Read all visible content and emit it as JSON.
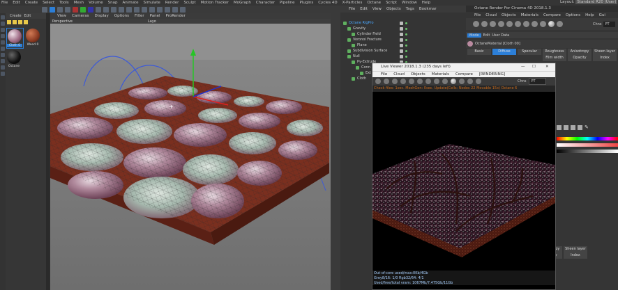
{
  "main_menu": [
    "File",
    "Edit",
    "Create",
    "Select",
    "Tools",
    "Mesh",
    "Volume",
    "Snap",
    "Animate",
    "Simulate",
    "Render",
    "Sculpt",
    "Motion Tracker",
    "MoGraph",
    "Character",
    "Pipeline",
    "Plugins",
    "Cycles 4D",
    "X-Particles",
    "Octane",
    "Script",
    "Window",
    "Help"
  ],
  "layout": {
    "label": "Layout:",
    "value": "Standard R20 (User)"
  },
  "material_manager": {
    "menu": [
      "Create",
      "Edit"
    ],
    "materials": [
      {
        "name": "Cloth 0",
        "color": "#b98aa0",
        "selected": true
      },
      {
        "name": "Wood 0",
        "color": "#8a3a22",
        "selected": false
      },
      {
        "name": "Octane",
        "color": "#1a1a1a",
        "selected": false
      }
    ]
  },
  "viewport": {
    "menu": [
      "View",
      "Cameras",
      "Display",
      "Options",
      "Filter",
      "Panel",
      "ProRender"
    ],
    "label": "Perspective",
    "label_right": "Layo"
  },
  "object_manager": {
    "menu": [
      "File",
      "Edit",
      "View",
      "Objects",
      "Tags",
      "Bookmar"
    ],
    "objects": [
      {
        "name": "Octane RigPro",
        "indent": 0,
        "color": "#4aa8ff"
      },
      {
        "name": "Gravity",
        "indent": 1,
        "color": "#d0d0d0"
      },
      {
        "name": "Cylinder Field",
        "indent": 2,
        "color": "#d0d0d0"
      },
      {
        "name": "Voronoi Fracture",
        "indent": 1,
        "color": "#d0d0d0"
      },
      {
        "name": "Plane",
        "indent": 2,
        "color": "#d0d0d0"
      },
      {
        "name": "Subdivision Surface",
        "indent": 1,
        "color": "#d0d0d0"
      },
      {
        "name": "Null",
        "indent": 1,
        "color": "#d0d0d0"
      },
      {
        "name": "Py-Extrude",
        "indent": 2,
        "color": "#d0d0d0"
      },
      {
        "name": "Conn",
        "indent": 3,
        "color": "#d0d0d0"
      },
      {
        "name": "Ext",
        "indent": 4,
        "color": "#d0d0d0"
      },
      {
        "name": "Cloth",
        "indent": 2,
        "color": "#d0d0d0"
      }
    ]
  },
  "octane_panel": {
    "title": "Octane Render For Cinema 4D 2018.1.3",
    "menu": [
      "File",
      "Cloud",
      "Objects",
      "Materials",
      "Compare",
      "Options",
      "Help",
      "Gui"
    ],
    "chn_label": "Chns",
    "chn_value": "PT",
    "attr_tabs": [
      "Mode",
      "Edit",
      "User Data"
    ],
    "material_name": "OctaneMaterial [Cloth 00]",
    "channels_row1": [
      "Basic",
      "Diffuse",
      "Specular",
      "Roughness",
      "Anisotropy",
      "Sheen layer"
    ],
    "channels_row2": [
      "",
      "",
      "",
      "Film width",
      "Opacity",
      "Index"
    ],
    "channels_row3": [
      "",
      "",
      "",
      "Anisotropy",
      "Sheen layer"
    ],
    "channels_row4": [
      "",
      "",
      "",
      "Opacity",
      "Index"
    ]
  },
  "live_viewer": {
    "title": "Live Viewer 2018.1.3 (235 days left)",
    "window_controls": [
      "—",
      "☐",
      "✕"
    ],
    "menu": [
      "File",
      "Cloud",
      "Objects",
      "Materials",
      "Compare",
      "[RENDERING]"
    ],
    "chn_label": "Chns",
    "chn_value": "PT",
    "status": "Check files: 1sec. MeshGen: 0sec. Update(Cells:  Nodes 22 Movable 15x) Octane 6",
    "footer": [
      "Out-of-core used/max:0Kb/4Gb",
      "Grey8/16: 1/0       Rgb32/64: 4/1",
      "Used/free/total vram: 1067Mb/7.475Gb/11Gb"
    ]
  },
  "colors": {
    "accent": "#2c7fd8",
    "status_orange": "#c96b1d"
  }
}
